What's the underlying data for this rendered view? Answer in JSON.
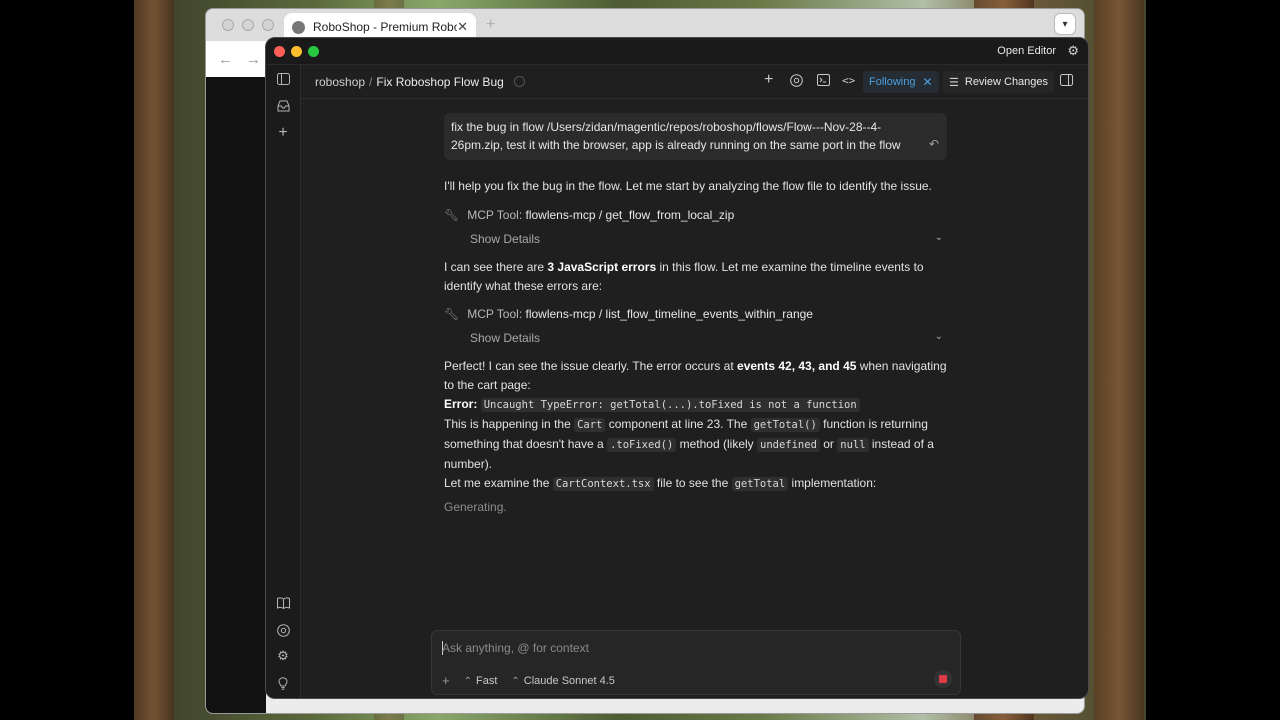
{
  "browser": {
    "tab_title": "RoboShop - Premium Robots",
    "new_tab": "+",
    "tab_close": "✕"
  },
  "app": {
    "open_editor": "Open Editor",
    "breadcrumb": {
      "repo": "roboshop",
      "separator": "/",
      "thread": "Fix Roboshop Flow Bug"
    },
    "following_label": "Following",
    "review_label": "Review Changes"
  },
  "chat": {
    "user_message": "fix the bug in flow /Users/zidan/magentic/repos/roboshop/flows/Flow---Nov-28--4-26pm.zip, test it with the browser, app is already running on the same port in the flow",
    "intro": "I'll help you fix the bug in the flow. Let me start by analyzing the flow file to identify the issue.",
    "tool1": {
      "label": "MCP Tool:",
      "value": "flowlens-mcp / get_flow_from_local_zip",
      "details": "Show Details"
    },
    "errors_pre": "I can see there are ",
    "errors_bold": "3 JavaScript errors",
    "errors_post": " in this flow. Let me examine the timeline events to identify what these errors are:",
    "tool2": {
      "label": "MCP Tool:",
      "value": "flowlens-mcp / list_flow_timeline_events_within_range",
      "details": "Show Details"
    },
    "perfect_pre": "Perfect! I can see the issue clearly. The error occurs at ",
    "perfect_bold": "events 42, 43, and 45",
    "perfect_post": " when navigating to the cart page:",
    "error_label": "Error:",
    "error_code": "Uncaught TypeError: getTotal(...).toFixed is not a function",
    "line1_a": "This is happening in the ",
    "line1_code1": "Cart",
    "line1_b": " component at line 23. The ",
    "line1_code2": "getTotal()",
    "line1_c": " function is returning something that doesn't have a ",
    "line1_code3": ".toFixed()",
    "line1_d": " method (likely ",
    "line1_code4": "undefined",
    "line1_e": " or ",
    "line1_code5": "null",
    "line1_f": " instead of a number).",
    "line2_a": "Let me examine the ",
    "line2_code1": "CartContext.tsx",
    "line2_b": " file to see the ",
    "line2_code2": "getTotal",
    "line2_c": " implementation:",
    "generating": "Generating."
  },
  "composer": {
    "placeholder": "Ask anything, @ for context",
    "add": "+",
    "mode": "Fast",
    "model": "Claude Sonnet 4.5"
  },
  "colors": {
    "accent": "#4b9fe0",
    "stop": "#e0394a",
    "close": "#ff5f57",
    "minimize": "#febc2e",
    "zoom": "#28c840"
  }
}
